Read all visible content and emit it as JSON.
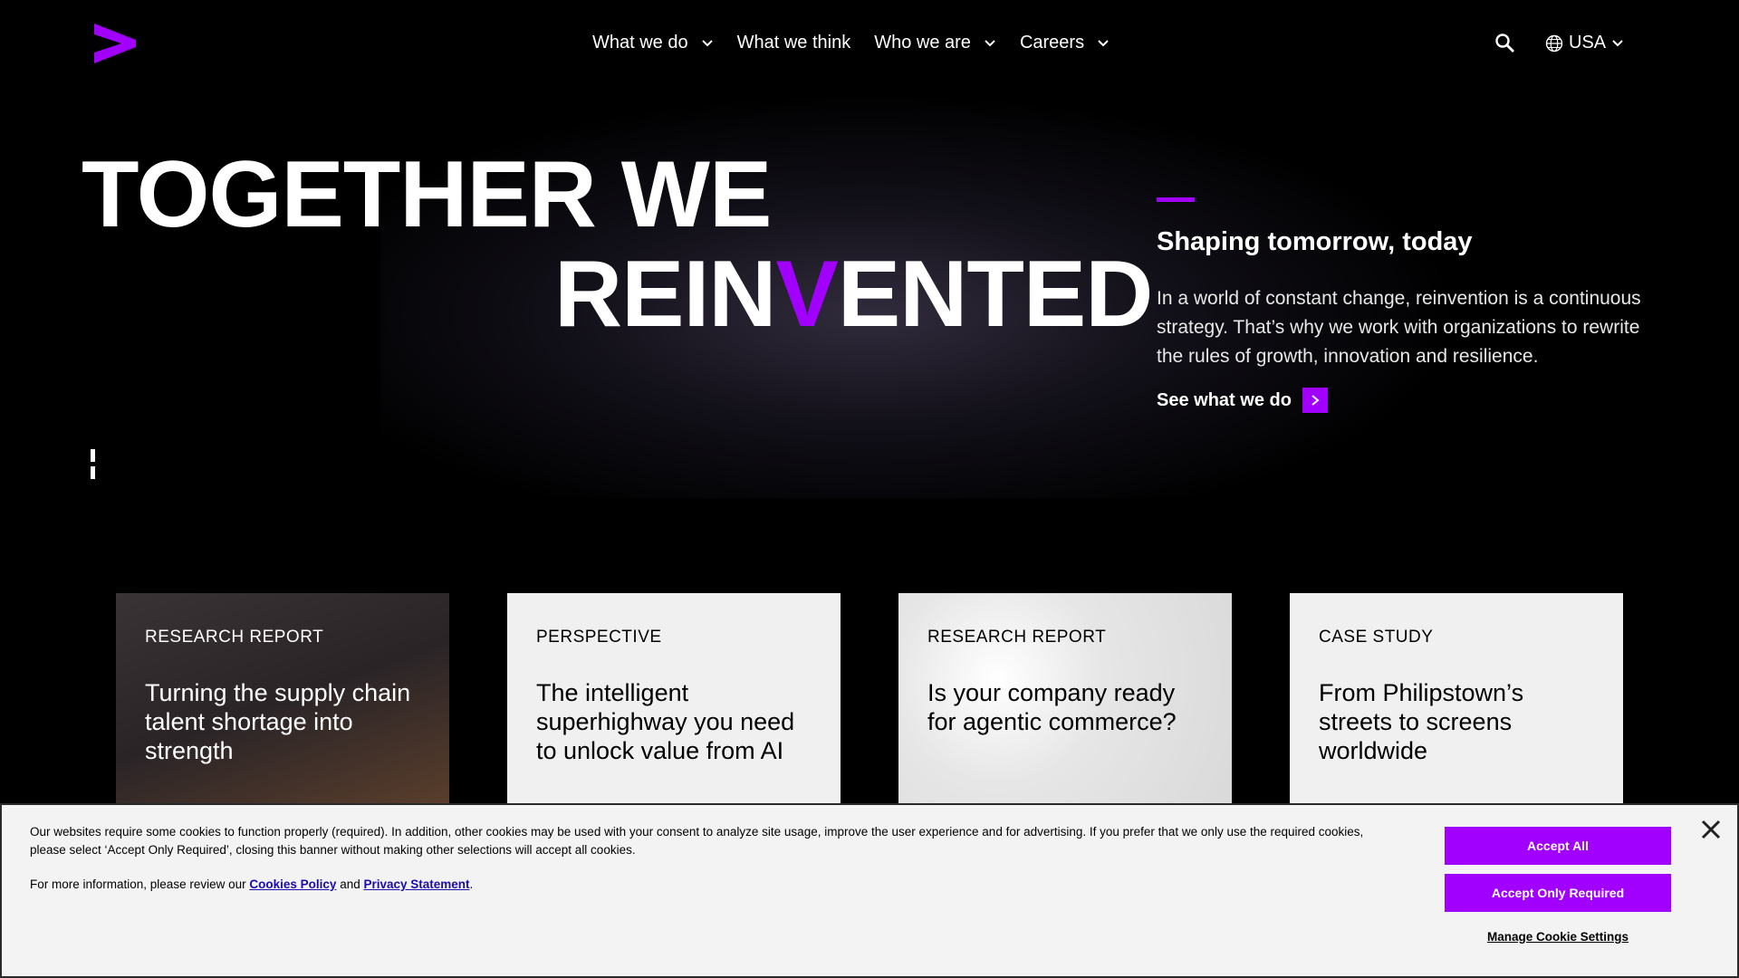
{
  "brand": {
    "accent_color": "#a100ff",
    "logo_icon": "accenture-chevron-logo"
  },
  "nav": {
    "items": [
      {
        "label": "What we do",
        "has_dropdown": true
      },
      {
        "label": "What we think",
        "has_dropdown": false
      },
      {
        "label": "Who we are",
        "has_dropdown": true
      },
      {
        "label": "Careers",
        "has_dropdown": true
      }
    ],
    "search_icon": "search-icon",
    "locale": "USA"
  },
  "hero": {
    "title_line1": "TOGETHER WE",
    "title_line2_part1": "REIN",
    "title_line2_accent": "V",
    "title_line2_part2": "ENTED",
    "subtitle": "Shaping tomorrow, today",
    "body": "In a world of constant change, reinvention is a continuous strategy. That’s why we work with organizations to rewrite the rules of growth, innovation and resilience.",
    "cta_label": "See what we do"
  },
  "cards": [
    {
      "type": "RESEARCH REPORT",
      "title": "Turning the supply chain talent shortage into strength"
    },
    {
      "type": "PERSPECTIVE",
      "title": "The intelligent superhighway you need to unlock value from AI"
    },
    {
      "type": "RESEARCH REPORT",
      "title": "Is your company ready for agentic commerce?"
    },
    {
      "type": "CASE STUDY",
      "title": "From Philipstown’s streets to screens worldwide"
    }
  ],
  "cookie": {
    "text": "Our websites require some cookies to function properly (required). In addition, other cookies may be used with your consent to analyze site usage, improve the user experience and for advertising. If you prefer that we only use the required cookies, please select ‘Accept Only Required’, closing this banner without making other selections will accept all cookies.",
    "more_prefix": "For more information, please review our",
    "cookies_policy": "Cookies Policy",
    "and": "and",
    "privacy_statement": "Privacy Statement",
    "period": ".",
    "accept_all": "Accept All",
    "accept_required": "Accept Only Required",
    "manage": "Manage Cookie Settings"
  }
}
